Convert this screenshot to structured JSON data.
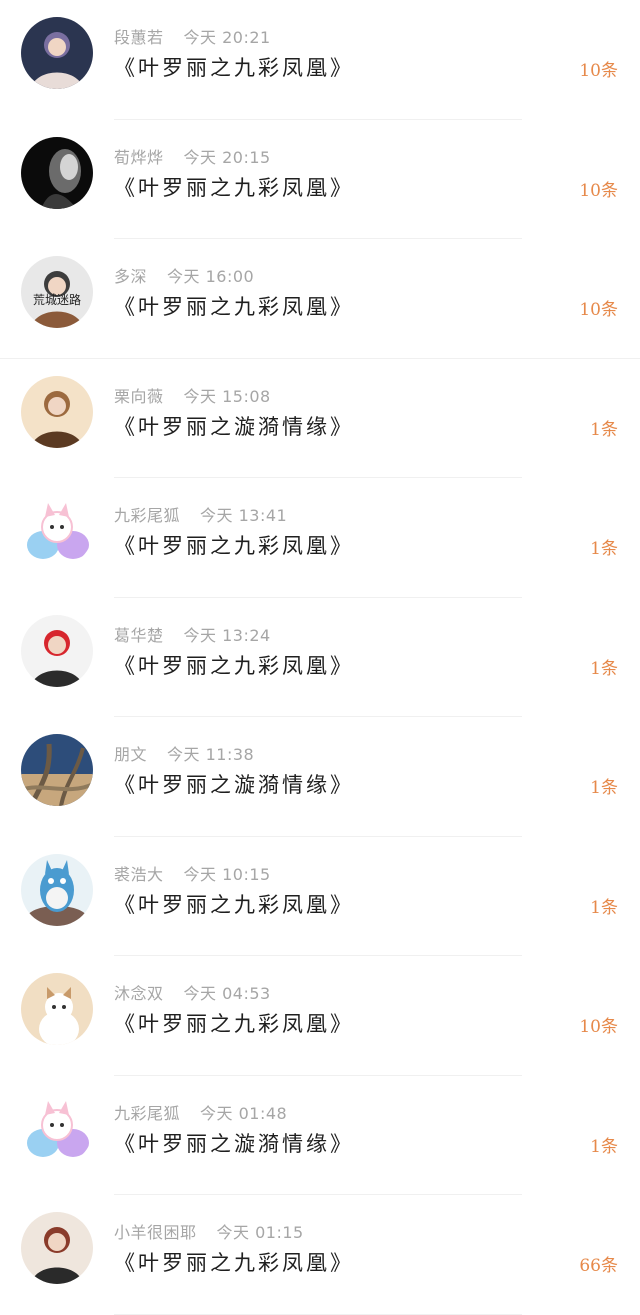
{
  "items": [
    {
      "name": "段蕙若",
      "time": "今天 20:21",
      "title": "《叶罗丽之九彩凤凰》",
      "count": "10条",
      "avatar": "anime-girl-avatar",
      "colors": [
        "#2b3550",
        "#7a6fa0",
        "#e8dcd8"
      ]
    },
    {
      "name": "荀烨烨",
      "time": "今天 20:15",
      "title": "《叶罗丽之九彩凤凰》",
      "count": "10条",
      "avatar": "dark-portrait-avatar",
      "colors": [
        "#0b0b0b",
        "#6b6b6b",
        "#d4d4d4"
      ]
    },
    {
      "name": "多深",
      "time": "今天 16:00",
      "title": "《叶罗丽之九彩凤凰》",
      "count": "10条",
      "avatar": "person-photo-avatar",
      "colors": [
        "#e8e8e8",
        "#3d3d3d",
        "#8b5a3a"
      ],
      "caption": "荒城迷路"
    },
    {
      "name": "栗向薇",
      "time": "今天 15:08",
      "title": "《叶罗丽之漩漪情缘》",
      "count": "1条",
      "avatar": "autumn-girl-avatar",
      "colors": [
        "#f4e2c8",
        "#9c6a3f",
        "#5b3a22"
      ]
    },
    {
      "name": "九彩尾狐",
      "time": "今天 13:41",
      "title": "《叶罗丽之九彩凤凰》",
      "count": "1条",
      "avatar": "fox-avatar",
      "colors": [
        "#ffffff",
        "#f7c1d4",
        "#9ad0f2"
      ]
    },
    {
      "name": "葛华楚",
      "time": "今天 13:24",
      "title": "《叶罗丽之九彩凤凰》",
      "count": "1条",
      "avatar": "red-sweater-girl-avatar",
      "colors": [
        "#f3f3f3",
        "#d7262d",
        "#2b2b2b"
      ]
    },
    {
      "name": "朋文",
      "time": "今天 11:38",
      "title": "《叶罗丽之漩漪情缘》",
      "count": "1条",
      "avatar": "tree-landscape-avatar",
      "colors": [
        "#2d4d7a",
        "#6c5a45",
        "#c7a77d"
      ]
    },
    {
      "name": "裘浩大",
      "time": "今天 10:15",
      "title": "《叶罗丽之九彩凤凰》",
      "count": "1条",
      "avatar": "totoro-avatar",
      "colors": [
        "#e9f2f6",
        "#4a9bd0",
        "#7a5e52"
      ]
    },
    {
      "name": "沐念双",
      "time": "今天 04:53",
      "title": "《叶罗丽之九彩凤凰》",
      "count": "10条",
      "avatar": "cat-avatar",
      "colors": [
        "#f1dec3",
        "#c89a6a",
        "#ffffff"
      ]
    },
    {
      "name": "九彩尾狐",
      "time": "今天 01:48",
      "title": "《叶罗丽之漩漪情缘》",
      "count": "1条",
      "avatar": "fox-avatar",
      "colors": [
        "#ffffff",
        "#f7c1d4",
        "#9ad0f2"
      ]
    },
    {
      "name": "小羊很困耶",
      "time": "今天 01:15",
      "title": "《叶罗丽之九彩凤凰》",
      "count": "66条",
      "avatar": "anime-warrior-avatar",
      "colors": [
        "#efe6dd",
        "#8a3b2a",
        "#2a2a2a"
      ]
    }
  ]
}
